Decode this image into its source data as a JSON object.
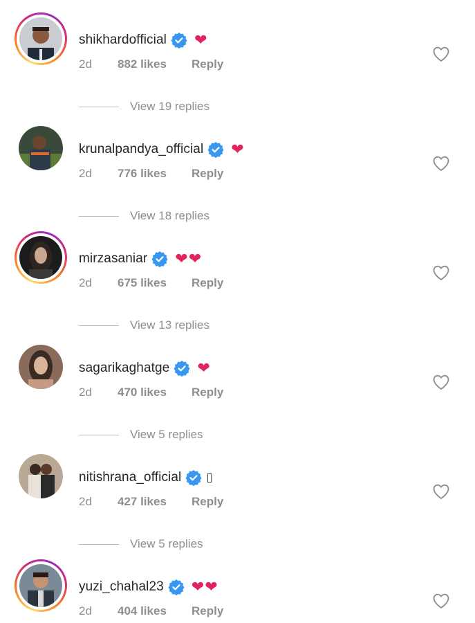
{
  "comments": [
    {
      "username": "shikhardofficial",
      "verified": true,
      "emoji": "❤",
      "time": "2d",
      "likes": "882 likes",
      "reply_label": "Reply",
      "view_replies": "View 19 replies",
      "story_ring": true
    },
    {
      "username": "krunalpandya_official",
      "verified": true,
      "emoji": "❤",
      "time": "2d",
      "likes": "776 likes",
      "reply_label": "Reply",
      "view_replies": "View 18 replies",
      "story_ring": false
    },
    {
      "username": "mirzasaniar",
      "verified": true,
      "emoji": "❤❤",
      "time": "2d",
      "likes": "675 likes",
      "reply_label": "Reply",
      "view_replies": "View 13 replies",
      "story_ring": true
    },
    {
      "username": "sagarikaghatge",
      "verified": true,
      "emoji": "❤",
      "time": "2d",
      "likes": "470 likes",
      "reply_label": "Reply",
      "view_replies": "View 5 replies",
      "story_ring": false
    },
    {
      "username": "nitishrana_official",
      "verified": true,
      "emoji": "▯",
      "time": "2d",
      "likes": "427 likes",
      "reply_label": "Reply",
      "view_replies": "View 5 replies",
      "story_ring": false
    },
    {
      "username": "yuzi_chahal23",
      "verified": true,
      "emoji": "❤❤",
      "time": "2d",
      "likes": "404 likes",
      "reply_label": "Reply",
      "story_ring": true
    }
  ],
  "icons": {
    "verified": "verified-badge-icon",
    "like": "heart-outline-icon"
  },
  "colors": {
    "verified": "#3897f0",
    "heart_emoji": "#e0245e",
    "meta_text": "#8e8e8e",
    "username_text": "#262626"
  }
}
